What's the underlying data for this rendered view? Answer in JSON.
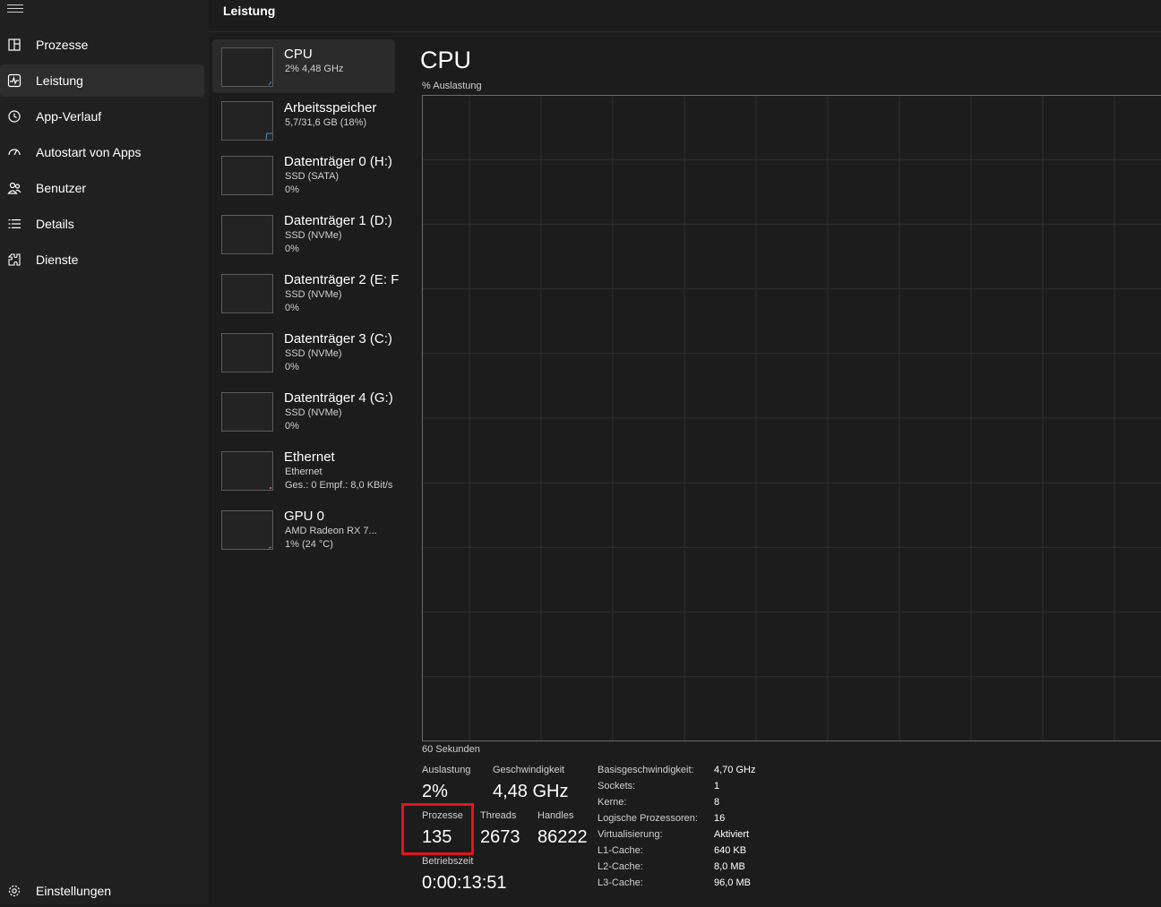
{
  "sidebar": {
    "items": [
      {
        "label": "Prozesse",
        "icon": "processes-icon"
      },
      {
        "label": "Leistung",
        "icon": "performance-icon"
      },
      {
        "label": "App-Verlauf",
        "icon": "history-icon"
      },
      {
        "label": "Autostart von Apps",
        "icon": "startup-icon"
      },
      {
        "label": "Benutzer",
        "icon": "users-icon"
      },
      {
        "label": "Details",
        "icon": "details-icon"
      },
      {
        "label": "Dienste",
        "icon": "services-icon"
      }
    ],
    "settings_label": "Einstellungen"
  },
  "header": {
    "title": "Leistung"
  },
  "perf_list": [
    {
      "name": "CPU",
      "sub1": "2% 4,48 GHz",
      "sub2": ""
    },
    {
      "name": "Arbeitsspeicher",
      "sub1": "5,7/31,6 GB (18%)",
      "sub2": ""
    },
    {
      "name": "Datenträger 0 (H:)",
      "sub1": "SSD (SATA)",
      "sub2": "0%"
    },
    {
      "name": "Datenträger 1 (D:)",
      "sub1": "SSD (NVMe)",
      "sub2": "0%"
    },
    {
      "name": "Datenträger 2 (E: F",
      "sub1": "SSD (NVMe)",
      "sub2": "0%"
    },
    {
      "name": "Datenträger 3 (C:)",
      "sub1": "SSD (NVMe)",
      "sub2": "0%"
    },
    {
      "name": "Datenträger 4 (G:)",
      "sub1": "SSD (NVMe)",
      "sub2": "0%"
    },
    {
      "name": "Ethernet",
      "sub1": "Ethernet",
      "sub2": "Ges.: 0 Empf.: 8,0 KBit/s"
    },
    {
      "name": "GPU 0",
      "sub1": "AMD Radeon RX 7...",
      "sub2": "1% (24 °C)"
    }
  ],
  "main": {
    "title": "CPU",
    "graph_label": "% Auslastung",
    "graph_footer": "60 Sekunden",
    "stats": {
      "auslastung_label": "Auslastung",
      "auslastung_value": "2%",
      "geschwindigkeit_label": "Geschwindigkeit",
      "geschwindigkeit_value": "4,48 GHz",
      "prozesse_label": "Prozesse",
      "prozesse_value": "135",
      "threads_label": "Threads",
      "threads_value": "2673",
      "handles_label": "Handles",
      "handles_value": "86222",
      "betriebszeit_label": "Betriebszeit",
      "betriebszeit_value": "0:00:13:51"
    },
    "specs": [
      {
        "label": "Basisgeschwindigkeit:",
        "value": "4,70 GHz"
      },
      {
        "label": "Sockets:",
        "value": "1"
      },
      {
        "label": "Kerne:",
        "value": "8"
      },
      {
        "label": "Logische Prozessoren:",
        "value": "16"
      },
      {
        "label": "Virtualisierung:",
        "value": "Aktiviert"
      },
      {
        "label": "L1-Cache:",
        "value": "640 KB"
      },
      {
        "label": "L2-Cache:",
        "value": "8,0 MB"
      },
      {
        "label": "L3-Cache:",
        "value": "96,0 MB"
      }
    ]
  },
  "colors": {
    "accent": "#4c8bd6",
    "highlight": "#e0161e"
  }
}
